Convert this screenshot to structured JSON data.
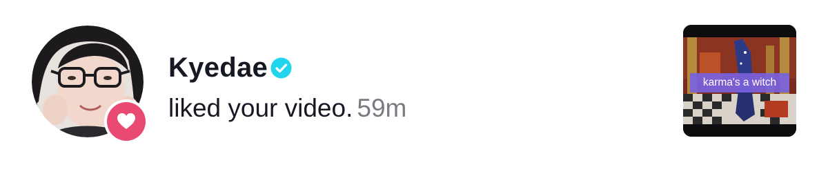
{
  "notification": {
    "user": {
      "username": "Kyedae",
      "verified": true,
      "avatar_icon": "avatar-photo"
    },
    "action_text": "liked your video.",
    "time": "59m",
    "badge_icon": "heart-icon",
    "video_thumbnail": {
      "caption": "karma's a witch"
    }
  },
  "colors": {
    "text_primary": "#161823",
    "text_secondary": "#7a7b82",
    "like_badge": "#e94a72",
    "verified_badge": "#20d5ec",
    "caption_bg": "#7862de"
  }
}
